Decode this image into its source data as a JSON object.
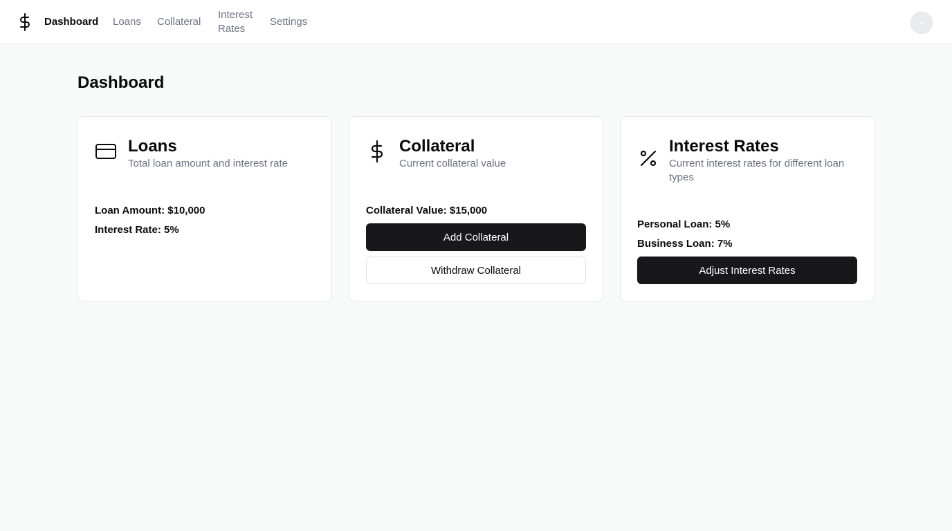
{
  "nav": {
    "logo_icon": "dollar-icon",
    "items": [
      {
        "label": "Dashboard",
        "active": true
      },
      {
        "label": "Loans",
        "active": false
      },
      {
        "label": "Collateral",
        "active": false
      },
      {
        "label": "Interest Rates",
        "active": false
      },
      {
        "label": "Settings",
        "active": false
      }
    ]
  },
  "page": {
    "title": "Dashboard"
  },
  "cards": {
    "loans": {
      "icon": "credit-card-icon",
      "title": "Loans",
      "description": "Total loan amount and interest rate",
      "loan_amount": "Loan Amount: $10,000",
      "interest_rate": "Interest Rate: 5%"
    },
    "collateral": {
      "icon": "dollar-icon",
      "title": "Collateral",
      "description": "Current collateral value",
      "value": "Collateral Value: $15,000",
      "add_button": "Add Collateral",
      "withdraw_button": "Withdraw Collateral"
    },
    "rates": {
      "icon": "percent-icon",
      "title": "Interest Rates",
      "description": "Current interest rates for different loan types",
      "personal": "Personal Loan: 5%",
      "business": "Business Loan: 7%",
      "adjust_button": "Adjust Interest Rates"
    }
  },
  "colors": {
    "background": "#f8f9f9",
    "primary_button": "#18181b",
    "muted_text": "#6b7280"
  }
}
